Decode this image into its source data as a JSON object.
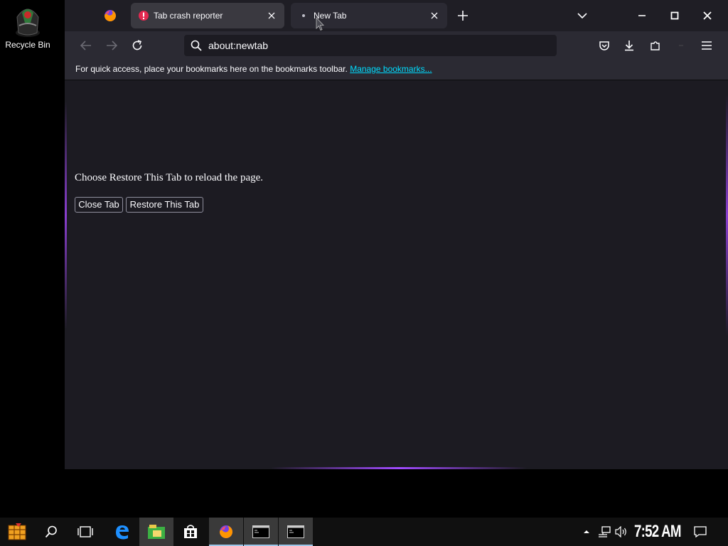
{
  "desktop": {
    "icons": [
      {
        "label": "Recycle Bin",
        "icon": "recycle-bin-icon"
      }
    ]
  },
  "browser": {
    "tabs": [
      {
        "title": "Tab crash reporter",
        "icon": "warning-icon",
        "active": false
      },
      {
        "title": "New Tab",
        "icon": "loading-dot-icon",
        "active": true
      }
    ],
    "url": "about:newtab",
    "bookmarks_bar": {
      "message": "For quick access, place your bookmarks here on the bookmarks toolbar.",
      "manage_link": "Manage bookmarks..."
    },
    "content": {
      "message": "Choose Restore This Tab to reload the page.",
      "close_tab_label": "Close Tab",
      "restore_tab_label": "Restore This Tab"
    }
  },
  "taskbar": {
    "clock": "7:52 AM",
    "apps": [
      "start",
      "search",
      "task-view",
      "edge",
      "file-explorer",
      "store",
      "firefox",
      "command-prompt",
      "command-prompt"
    ]
  },
  "colors": {
    "accent": "#00ddff",
    "glow": "#a04bff",
    "warning": "#e22850"
  }
}
